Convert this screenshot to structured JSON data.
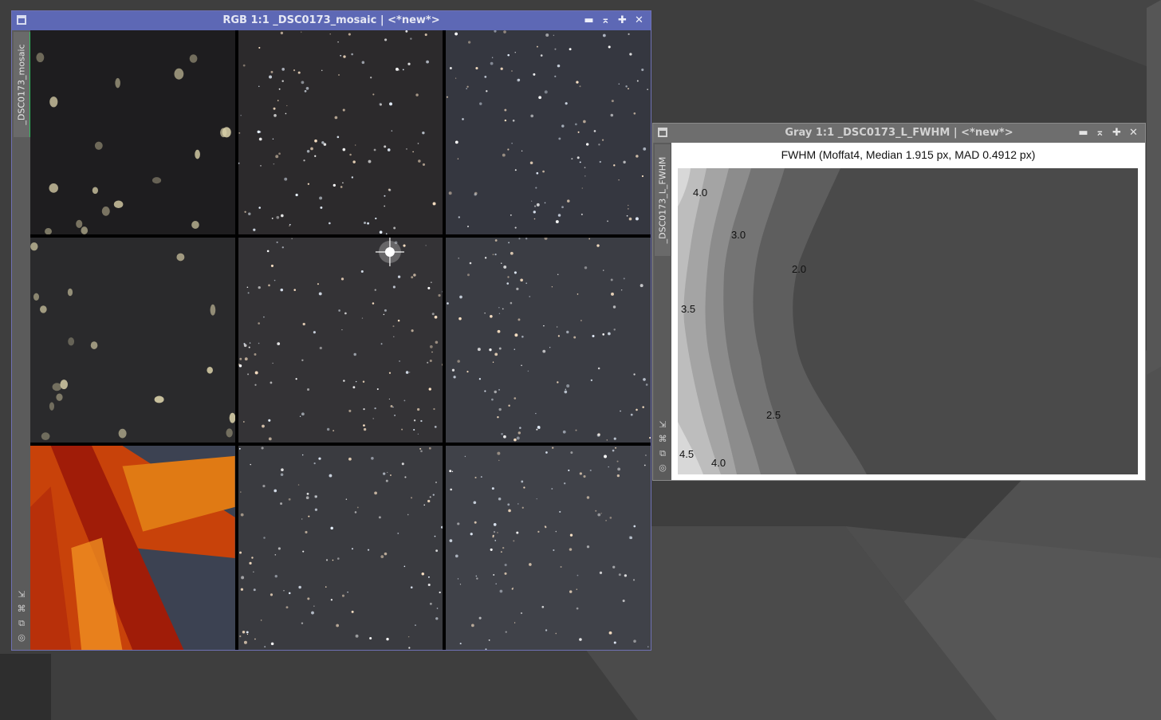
{
  "rgb_window": {
    "title": "RGB 1:1 _DSC0173_mosaic | <*new*>",
    "side_tab_label": "_DSC0173_mosaic",
    "active_tab_color": "#30c060",
    "title_bar_color": "#5d68b5",
    "controls": [
      {
        "name": "minimize",
        "glyph": "▬"
      },
      {
        "name": "shade",
        "glyph": "⌅"
      },
      {
        "name": "maximize",
        "glyph": "✚"
      },
      {
        "name": "close",
        "glyph": "✕"
      }
    ],
    "side_icons": [
      {
        "name": "shrink-icon",
        "glyph": "⇲"
      },
      {
        "name": "fit-view-icon",
        "glyph": "⌘"
      },
      {
        "name": "clone-icon",
        "glyph": "⧉"
      },
      {
        "name": "target-icon",
        "glyph": "◎"
      }
    ],
    "mosaic": {
      "rows": 3,
      "cols": 3,
      "tiles": [
        {
          "scene": "out-of-focus corner stars",
          "bg": "#1e1d1f"
        },
        {
          "scene": "star field",
          "bg": "#2c2a2c"
        },
        {
          "scene": "star field",
          "bg": "#353740"
        },
        {
          "scene": "out-of-focus corner stars",
          "bg": "#2a2a2c"
        },
        {
          "scene": "star field with bright star",
          "bg": "#343336"
        },
        {
          "scene": "star field",
          "bg": "#3b3d44"
        },
        {
          "scene": "orange telescope structure",
          "bg": "#3c4252"
        },
        {
          "scene": "star field",
          "bg": "#3a3b40"
        },
        {
          "scene": "star field",
          "bg": "#404249"
        }
      ]
    }
  },
  "fwhm_window": {
    "title": "Gray 1:1 _DSC0173_L_FWHM | <*new*>",
    "side_tab_label": "_DSC0173_L_FWHM",
    "controls": [
      {
        "name": "minimize",
        "glyph": "▬"
      },
      {
        "name": "shade",
        "glyph": "⌅"
      },
      {
        "name": "maximize",
        "glyph": "✚"
      },
      {
        "name": "close",
        "glyph": "✕"
      }
    ],
    "side_icons": [
      {
        "name": "shrink-icon",
        "glyph": "⇲"
      },
      {
        "name": "fit-view-icon",
        "glyph": "⌘"
      },
      {
        "name": "clone-icon",
        "glyph": "⧉"
      },
      {
        "name": "target-icon",
        "glyph": "◎"
      }
    ],
    "plot": {
      "title": "FWHM (Moffat4, Median 1.915 px, MAD 0.4912 px)",
      "contour_labels": [
        "4.0",
        "3.0",
        "2.0",
        "3.5",
        "2.5",
        "4.5",
        "4.0"
      ],
      "band_colors": [
        "#d8d8d8",
        "#bdbdbd",
        "#a4a4a4",
        "#8c8c8c",
        "#747474",
        "#5e5e5e",
        "#4a4a4a"
      ]
    }
  }
}
